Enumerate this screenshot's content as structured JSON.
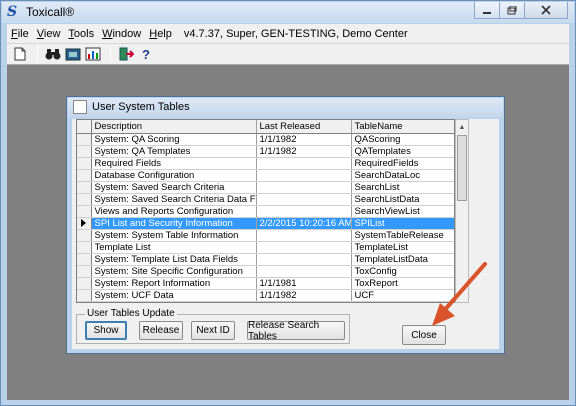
{
  "app": {
    "title": "Toxicall®",
    "info": "v4.7.37, Super, GEN-TESTING, Demo Center",
    "icon": "app-logo-icon"
  },
  "menu": {
    "items": [
      "File",
      "View",
      "Tools",
      "Window",
      "Help"
    ]
  },
  "toolbar": {
    "icons": [
      "new-document-icon",
      "binoculars-icon",
      "camera-icon",
      "chart-icon",
      "exit-icon",
      "help-icon"
    ],
    "help_glyph": "?"
  },
  "dialog": {
    "title": "User System Tables",
    "columns": [
      "Description",
      "Last Released",
      "TableName"
    ],
    "rows": [
      [
        "System: QA Scoring",
        "1/1/1982",
        "QAScoring"
      ],
      [
        "System: QA Templates",
        "1/1/1982",
        "QATemplates"
      ],
      [
        "Required Fields",
        "",
        "RequiredFields"
      ],
      [
        "Database Configuration",
        "",
        "SearchDataLoc"
      ],
      [
        "System: Saved Search Criteria",
        "",
        "SearchList"
      ],
      [
        "System: Saved Search Criteria Data Fields",
        "",
        "SearchListData"
      ],
      [
        "Views and Reports Configuration",
        "",
        "SearchViewList"
      ],
      [
        "SPI List and Security Information",
        "2/2/2015 10:20:16 AM",
        "SPIList"
      ],
      [
        "System: System Table Information",
        "",
        "SystemTableRelease"
      ],
      [
        "Template List",
        "",
        "TemplateList"
      ],
      [
        "System: Template List Data Fields",
        "",
        "TemplateListData"
      ],
      [
        "System: Site Specific Configuration",
        "",
        "ToxConfig"
      ],
      [
        "System: Report Information",
        "1/1/1981",
        "ToxReport"
      ],
      [
        "System: UCF Data",
        "1/1/1982",
        "UCF"
      ]
    ],
    "selected_row": 7,
    "group_label": "User Tables Update",
    "buttons": {
      "show": "Show",
      "release": "Release",
      "next_id": "Next ID",
      "release_search": "Release Search Tables",
      "close": "Close"
    }
  },
  "colors": {
    "selection": "#3399ff",
    "annotation_arrow": "#d9542b",
    "workspace": "#808080"
  }
}
